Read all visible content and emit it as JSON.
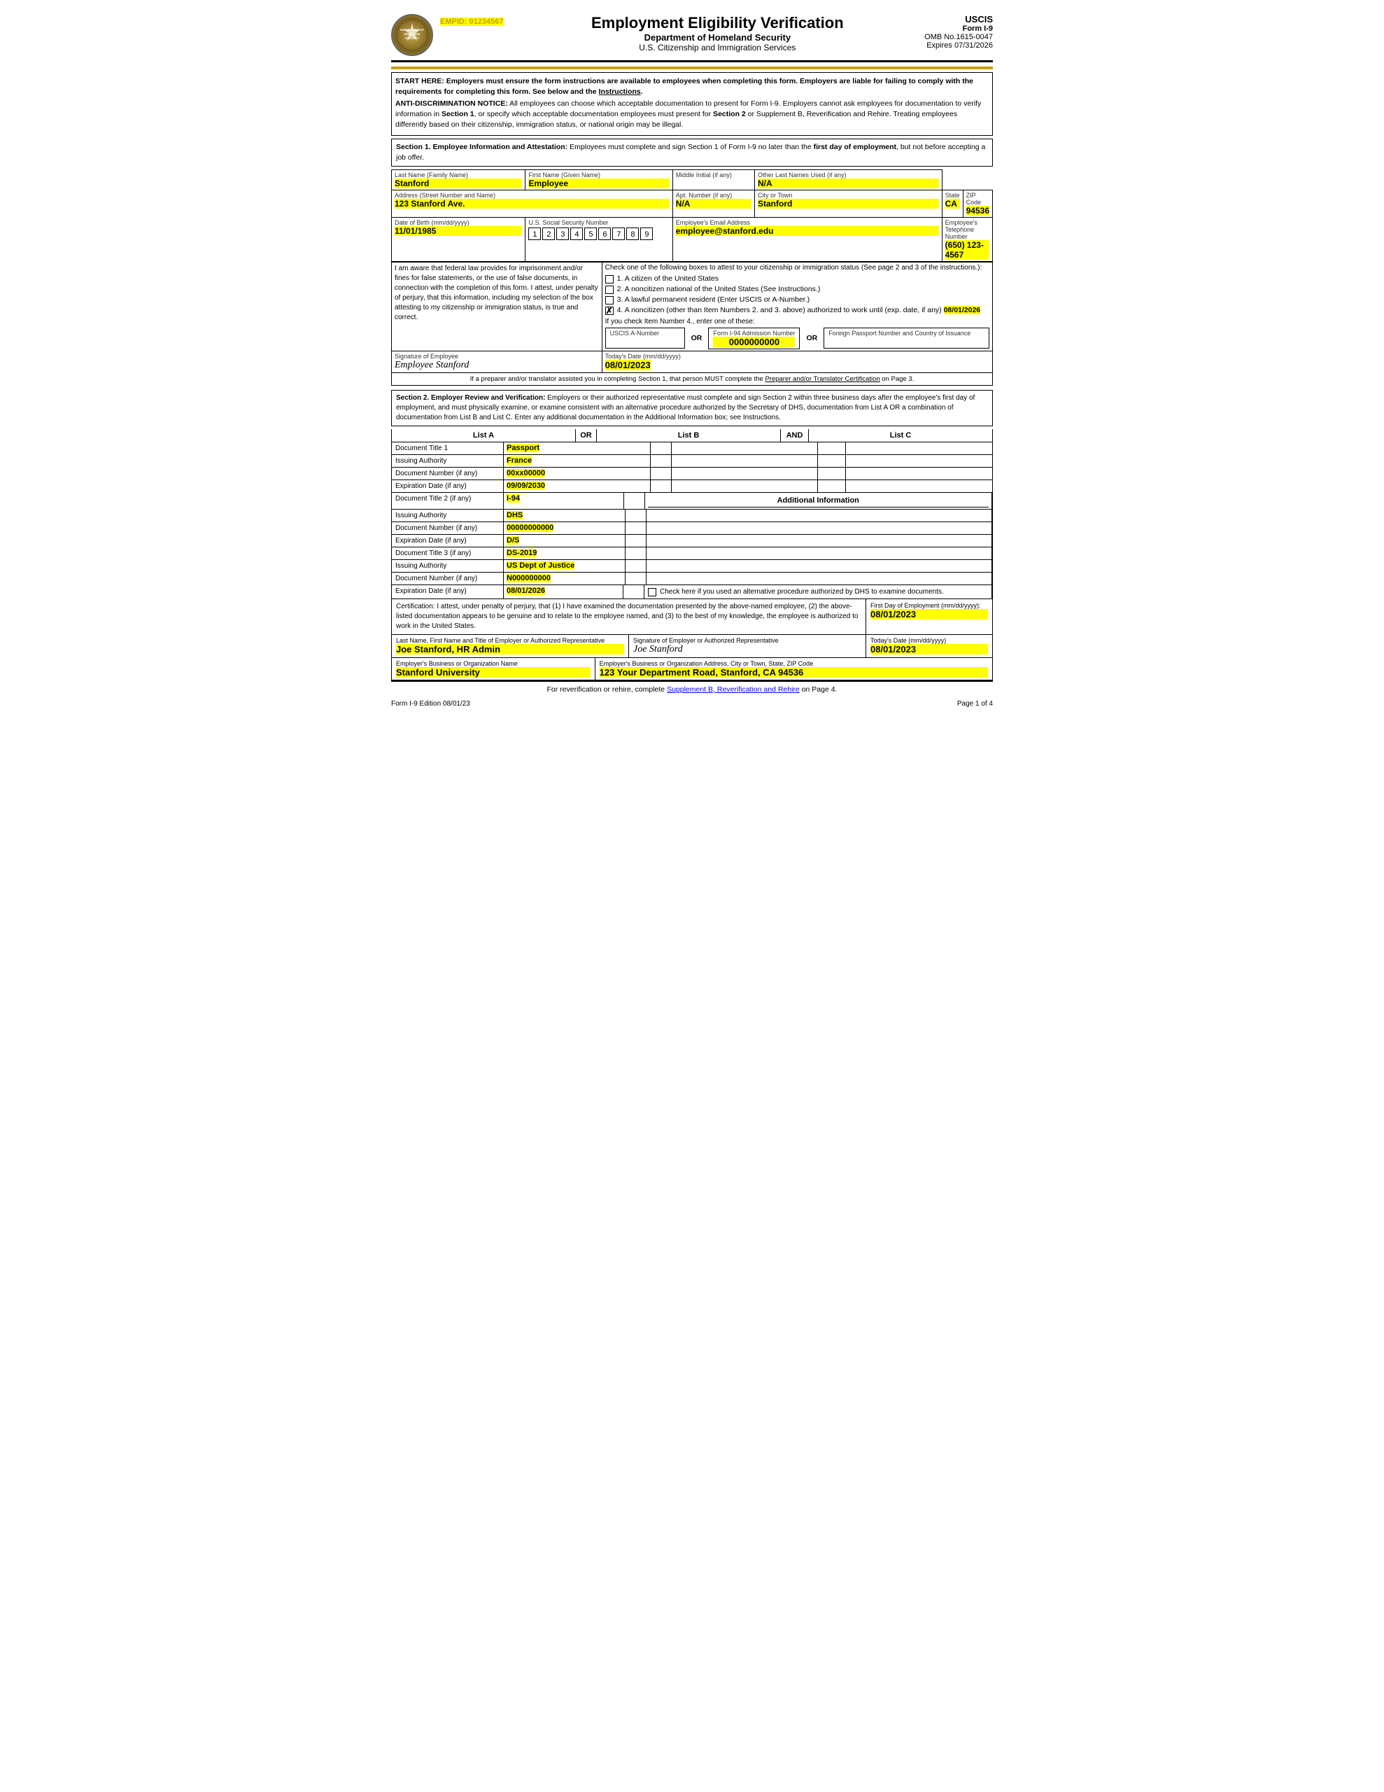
{
  "header": {
    "empid_label": "EMPID: 01234567",
    "main_title": "Employment Eligibility Verification",
    "sub_title": "Department of Homeland Security",
    "sub_title2": "U.S. Citizenship and Immigration Services",
    "uscis": "USCIS",
    "form": "Form I-9",
    "omb": "OMB No.1615-0047",
    "expires": "Expires 07/31/2026"
  },
  "notices": {
    "start_here": "START HERE:  Employers must ensure the form instructions are available to employees when completing this form.  Employers are liable for failing to comply with the requirements for completing this form.  See below and the Instructions.",
    "anti_disc": "ANTI-DISCRIMINATION NOTICE:  All employees can choose which acceptable documentation to present for Form I-9.  Employers cannot ask employees for documentation to verify information in Section 1, or specify which acceptable documentation employees must present for Section 2 or Supplement B, Reverification and Rehire.  Treating employees differently based on their citizenship, immigration status, or national origin may be illegal."
  },
  "section1": {
    "header": "Section 1. Employee Information and Attestation: Employees must complete and sign Section 1 of Form I-9 no later than the first day of employment, but not before accepting a job offer.",
    "last_name_label": "Last Name (Family Name)",
    "last_name": "Stanford",
    "first_name_label": "First Name (Given Name)",
    "first_name": "Employee",
    "middle_initial_label": "Middle Initial (if any)",
    "middle_initial": "",
    "other_names_label": "Other Last Names Used (if any)",
    "other_names": "N/A",
    "address_label": "Address (Street Number and Name)",
    "address": "123 Stanford Ave.",
    "apt_label": "Apt. Number (if any)",
    "apt": "N/A",
    "city_label": "City or Town",
    "city": "Stanford",
    "state_label": "State",
    "state": "CA",
    "zip_label": "ZIP Code",
    "zip": "94536",
    "dob_label": "Date of Birth (mm/dd/yyyy)",
    "dob": "11/01/1985",
    "ssn_label": "U.S. Social Security Number",
    "ssn_digits": [
      "1",
      "2",
      "3",
      "4",
      "5",
      "6",
      "7",
      "8",
      "9"
    ],
    "email_label": "Employee's Email Address",
    "email": "employee@stanford.edu",
    "phone_label": "Employee's Telephone Number",
    "phone": "(650) 123-4567",
    "attestation_left": "I am aware that federal law provides for imprisonment and/or fines for false statements, or the use of false documents, in connection with the completion of this form. I attest, under penalty of perjury, that this information, including my selection of the box attesting to my citizenship or immigration status, is true and correct.",
    "check_intro": "Check one of the following boxes to attest to your citizenship or immigration status (See page 2 and 3 of the instructions.):",
    "option1": "A citizen of the United States",
    "option2": "A noncitizen national of the United States (See Instructions.)",
    "option3": "A lawful permanent resident (Enter USCIS or A-Number.)",
    "option4": "A noncitizen (other than Item Numbers 2. and 3. above) authorized to work until (exp. date, if any)",
    "option4_date": "08/01/2026",
    "item4_note": "If you check Item Number 4., enter one of these:",
    "uscis_a_label": "USCIS A-Number",
    "or1": "OR",
    "i94_label": "Form I-94 Admission Number",
    "i94_value": "0000000000",
    "or2": "OR",
    "passport_label": "Foreign Passport Number and Country of Issuance",
    "sig_label": "Signature of Employee",
    "signature": "Employee Stanford",
    "date_label": "Today's Date (mm/dd/yyyy)",
    "date": "08/01/2023",
    "preparer_note": "If a preparer and/or translator assisted you in completing Section 1, that person MUST complete the Preparer and/or Translator Certification on Page 3."
  },
  "section2": {
    "header": "Section 2. Employer Review and Verification: Employers or their authorized representative must complete and sign Section 2 within three business days after the employee's first day of employment, and must physically examine, or examine consistent with an alternative procedure authorized by the Secretary of DHS, documentation from List A OR a combination of documentation from List B and List C.  Enter any additional documentation in the Additional Information box; see Instructions.",
    "list_a": "List A",
    "or_label": "OR",
    "list_b": "List B",
    "and_label": "AND",
    "list_c": "List C",
    "doc1_title_label": "Document Title 1",
    "doc1_title": "Passport",
    "doc1_issuing_label": "Issuing Authority",
    "doc1_issuing": "France",
    "doc1_number_label": "Document Number (if any)",
    "doc1_number": "00xx00000",
    "doc1_exp_label": "Expiration Date (if any)",
    "doc1_exp": "09/09/2030",
    "doc2_title_label": "Document Title 2 (if any)",
    "doc2_title": "I-94",
    "additional_info_header": "Additional Information",
    "doc2_issuing_label": "Issuing Authority",
    "doc2_issuing": "DHS",
    "doc2_number_label": "Document Number (if any)",
    "doc2_number": "00000000000",
    "doc2_exp_label": "Expiration Date (if any)",
    "doc2_exp": "D/S",
    "doc3_title_label": "Document Title 3 (if any)",
    "doc3_title": "DS-2019",
    "doc3_issuing_label": "Issuing Authority",
    "doc3_issuing": "US Dept of Justice",
    "doc3_number_label": "Document Number (if any)",
    "doc3_number": "N000000000",
    "doc3_exp_label": "Expiration Date (if any)",
    "doc3_exp": "08/01/2026",
    "alt_procedure_note": "Check here if you used an alternative procedure authorized by DHS to examine documents.",
    "cert_text": "Certification: I attest, under penalty of perjury, that (1) I have examined the documentation presented by the above-named employee, (2) the above-listed documentation appears to be genuine and to relate to the employee named, and (3) to the best of my knowledge, the employee is authorized to work in the United States.",
    "first_day_label": "First Day of Employment (mm/dd/yyyy):",
    "first_day": "08/01/2023",
    "employer_name_label": "Last Name, First Name and Title of Employer or Authorized Representative",
    "employer_name": "Joe Stanford, HR Admin",
    "sig_label": "Signature of Employer or Authorized Representative",
    "employer_signature": "Joe Stanford",
    "today_date_label": "Today's Date (mm/dd/yyyy)",
    "today_date": "08/01/2023",
    "org_name_label": "Employer's Business or Organization Name",
    "org_name": "Stanford University",
    "org_address_label": "Employer's Business or Organization Address, City or Town, State, ZIP Code",
    "org_address": "123 Your Department Road, Stanford, CA 94536"
  },
  "footer": {
    "supplement_note": "For reverification or rehire, complete Supplement B, Reverification and Rehire on Page 4.",
    "edition": "Form I-9  Edition  08/01/23",
    "page": "Page 1 of 4"
  }
}
